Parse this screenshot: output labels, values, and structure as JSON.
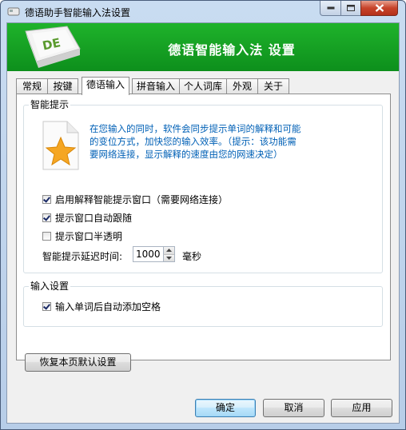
{
  "window": {
    "title": "德语助手智能输入法设置"
  },
  "banner": {
    "logo_text": "DE",
    "title": "德语智能输入法 设置"
  },
  "tabs": [
    {
      "label": "常规"
    },
    {
      "label": "按键"
    },
    {
      "label": "德语输入"
    },
    {
      "label": "拼音输入"
    },
    {
      "label": "个人词库"
    },
    {
      "label": "外观"
    },
    {
      "label": "关于"
    }
  ],
  "active_tab": "德语输入",
  "smart_hint": {
    "group_title": "智能提示",
    "description_lines": [
      "在您输入的同时，软件会同步提示单词的解释和可能",
      "的变位方式，加快您的输入效率。（提示：该功能需",
      "要网络连接，显示解释的速度由您的网速决定）"
    ],
    "options": [
      {
        "label": "启用解释智能提示窗口（需要网络连接）",
        "checked": true
      },
      {
        "label": "提示窗口自动跟随",
        "checked": true
      },
      {
        "label": "提示窗口半透明",
        "checked": false
      }
    ],
    "delay_label": "智能提示延迟时间:",
    "delay_value": "1000",
    "delay_unit": "毫秒"
  },
  "input_settings": {
    "group_title": "输入设置",
    "options": [
      {
        "label": "输入单词后自动添加空格",
        "checked": true
      }
    ]
  },
  "restore_button": "恢复本页默认设置",
  "footer": {
    "ok": "确定",
    "cancel": "取消",
    "apply": "应用"
  },
  "colors": {
    "banner_green": "#13a323",
    "hint_blue": "#0060b6",
    "star_orange": "#f5a623"
  }
}
